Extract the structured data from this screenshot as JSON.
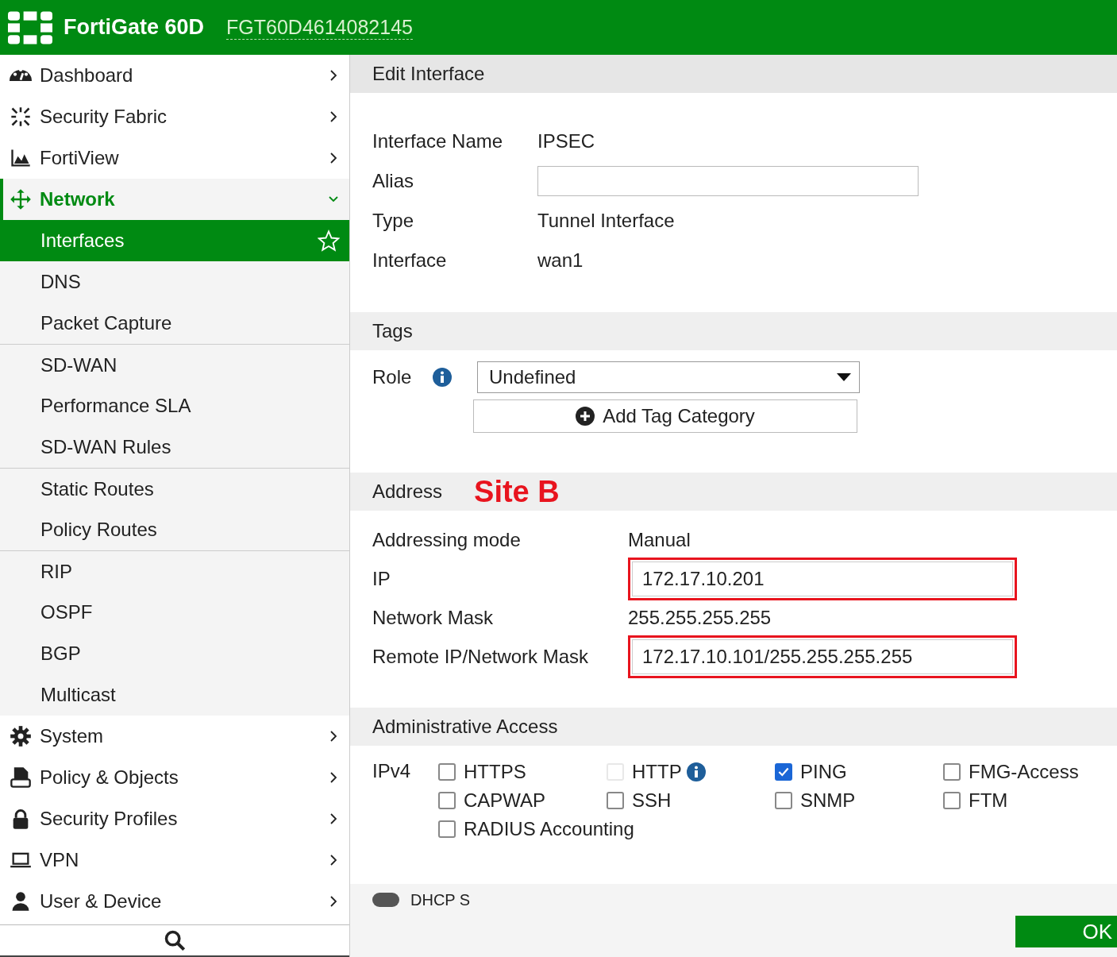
{
  "header": {
    "product": "FortiGate 60D",
    "serial": "FGT60D4614082145"
  },
  "sidebar": {
    "items": [
      {
        "label": "Dashboard",
        "expanded": false
      },
      {
        "label": "Security Fabric",
        "expanded": false
      },
      {
        "label": "FortiView",
        "expanded": false
      },
      {
        "label": "Network",
        "expanded": true,
        "children": [
          {
            "label": "Interfaces",
            "selected": true,
            "divider_before": false
          },
          {
            "label": "DNS",
            "selected": false,
            "divider_before": false
          },
          {
            "label": "Packet Capture",
            "selected": false,
            "divider_before": false
          },
          {
            "label": "SD-WAN",
            "selected": false,
            "divider_before": true
          },
          {
            "label": "Performance SLA",
            "selected": false,
            "divider_before": false
          },
          {
            "label": "SD-WAN Rules",
            "selected": false,
            "divider_before": false
          },
          {
            "label": "Static Routes",
            "selected": false,
            "divider_before": true
          },
          {
            "label": "Policy Routes",
            "selected": false,
            "divider_before": false
          },
          {
            "label": "RIP",
            "selected": false,
            "divider_before": true
          },
          {
            "label": "OSPF",
            "selected": false,
            "divider_before": false
          },
          {
            "label": "BGP",
            "selected": false,
            "divider_before": false
          },
          {
            "label": "Multicast",
            "selected": false,
            "divider_before": false
          }
        ]
      },
      {
        "label": "System",
        "expanded": false
      },
      {
        "label": "Policy & Objects",
        "expanded": false
      },
      {
        "label": "Security Profiles",
        "expanded": false
      },
      {
        "label": "VPN",
        "expanded": false
      },
      {
        "label": "User & Device",
        "expanded": false
      }
    ]
  },
  "form": {
    "title": "Edit Interface",
    "fields": [
      {
        "label": "Interface Name",
        "kind": "text",
        "value": "IPSEC"
      },
      {
        "label": "Alias",
        "kind": "input"
      },
      {
        "label": "Type",
        "kind": "text",
        "value": "Tunnel Interface"
      },
      {
        "label": "Interface",
        "kind": "text",
        "value": "wan1"
      }
    ],
    "tags": {
      "title": "Tags",
      "role_label": "Role",
      "role_value": "Undefined",
      "add_button": "Add Tag Category"
    },
    "address": {
      "title": "Address",
      "annotation": "Site B",
      "fields": [
        {
          "label": "Addressing mode",
          "kind": "text",
          "value": "Manual"
        },
        {
          "label": "IP",
          "kind": "input",
          "value": "172.17.10.201",
          "highlighted": true
        },
        {
          "label": "Network Mask",
          "kind": "text",
          "value": "255.255.255.255"
        },
        {
          "label": "Remote IP/Network Mask",
          "kind": "input",
          "value": "172.17.10.101/255.255.255.255",
          "highlighted": true
        }
      ]
    },
    "admin_access": {
      "title": "Administrative Access",
      "protocol": "IPv4",
      "options": [
        {
          "label": "HTTPS",
          "checked": false,
          "disabled": false,
          "info": false
        },
        {
          "label": "HTTP",
          "checked": false,
          "disabled": true,
          "info": true
        },
        {
          "label": "PING",
          "checked": true,
          "disabled": false,
          "info": false
        },
        {
          "label": "FMG-Access",
          "checked": false,
          "disabled": false,
          "info": false
        },
        {
          "label": "CAPWAP",
          "checked": false,
          "disabled": false,
          "info": false
        },
        {
          "label": "SSH",
          "checked": false,
          "disabled": false,
          "info": false
        },
        {
          "label": "SNMP",
          "checked": false,
          "disabled": false,
          "info": false
        },
        {
          "label": "FTM",
          "checked": false,
          "disabled": false,
          "info": false
        },
        {
          "label": "RADIUS Accounting",
          "checked": false,
          "disabled": false,
          "info": false
        }
      ]
    },
    "next_section": {
      "title": "DHCP S",
      "on": false
    },
    "ok_button": "OK"
  }
}
